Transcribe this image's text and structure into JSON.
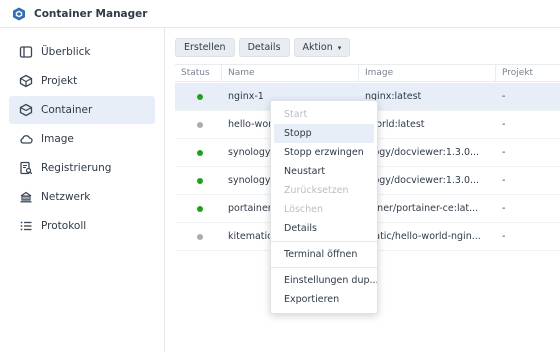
{
  "app": {
    "title": "Container Manager"
  },
  "sidebar": {
    "items": [
      {
        "label": "Überblick",
        "icon": "overview-icon",
        "active": false
      },
      {
        "label": "Projekt",
        "icon": "project-icon",
        "active": false
      },
      {
        "label": "Container",
        "icon": "container-icon",
        "active": true
      },
      {
        "label": "Image",
        "icon": "cloud-icon",
        "active": false
      },
      {
        "label": "Registrierung",
        "icon": "registry-icon",
        "active": false
      },
      {
        "label": "Netzwerk",
        "icon": "network-icon",
        "active": false
      },
      {
        "label": "Protokoll",
        "icon": "log-icon",
        "active": false
      }
    ]
  },
  "toolbar": {
    "create_label": "Erstellen",
    "details_label": "Details",
    "action_label": "Aktion"
  },
  "table": {
    "headers": {
      "status": "Status",
      "name": "Name",
      "image": "Image",
      "project": "Projekt"
    },
    "rows": [
      {
        "status": "running",
        "name": "nginx-1",
        "image": "nginx:latest",
        "project": "-"
      },
      {
        "status": "stopped",
        "name": "hello-wor",
        "image": "-world:latest",
        "project": "-"
      },
      {
        "status": "running",
        "name": "synology",
        "image": "ology/docviewer:1.3.0...",
        "project": "-"
      },
      {
        "status": "running",
        "name": "synology",
        "image": "ology/docviewer:1.3.0...",
        "project": "-"
      },
      {
        "status": "running",
        "name": "portainer",
        "image": "tainer/portainer-ce:lat...",
        "project": "-"
      },
      {
        "status": "stopped",
        "name": "kitematic",
        "image": "matic/hello-world-ngin...",
        "project": "-"
      }
    ]
  },
  "context_menu": {
    "items": [
      {
        "label": "Start",
        "disabled": true
      },
      {
        "label": "Stopp",
        "disabled": false,
        "hover": true
      },
      {
        "label": "Stopp erzwingen",
        "disabled": false
      },
      {
        "label": "Neustart",
        "disabled": false
      },
      {
        "label": "Zurücksetzen",
        "disabled": true
      },
      {
        "label": "Löschen",
        "disabled": true
      },
      {
        "label": "Details",
        "disabled": false
      },
      {
        "label": "Terminal öffnen",
        "disabled": false
      },
      {
        "label": "Einstellungen dup...",
        "disabled": false
      },
      {
        "label": "Exportieren",
        "disabled": false
      }
    ]
  },
  "colors": {
    "running": "#1fa31f",
    "stopped": "#a8adb3",
    "selected": "#e7eef7",
    "accent": "#2f6db5"
  }
}
